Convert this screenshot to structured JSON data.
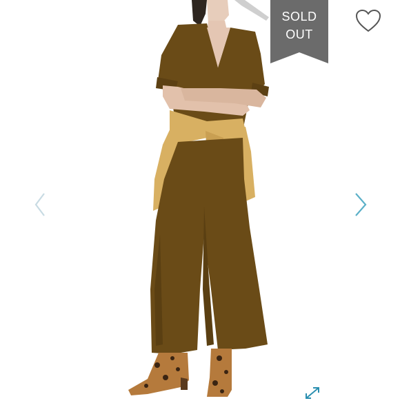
{
  "listing": {
    "status_banner": {
      "line1": "SOLD",
      "line2": "OUT"
    }
  },
  "controls": {
    "previous": "previous-image",
    "next": "next-image",
    "like": "heart-icon",
    "expand": "expand-icon"
  },
  "colors": {
    "banner": "#6b6b6b",
    "arrow": "#5bb0c8",
    "arrow_disabled": "#c8dbe3",
    "jumpsuit": "#6a4b17",
    "cardigan": "#d8b062"
  }
}
